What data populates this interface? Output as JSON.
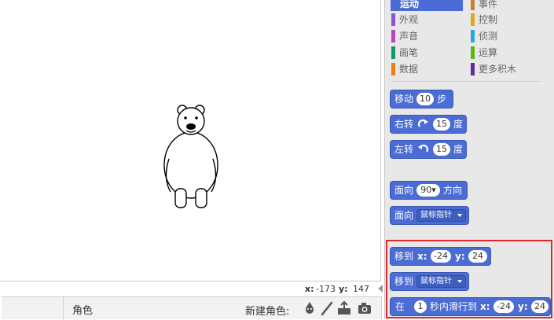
{
  "stage": {
    "coords_x_label": "x:",
    "coords_x_value": "-173",
    "coords_y_label": "y:",
    "coords_y_value": "147"
  },
  "sprite_bar": {
    "title": "角色",
    "new_sprite_label": "新建角色:"
  },
  "categories": {
    "left": [
      "运动",
      "外观",
      "声音",
      "画笔",
      "数据"
    ],
    "right": [
      "事件",
      "控制",
      "侦测",
      "运算",
      "更多积木"
    ],
    "left_colors": [
      "#4a6cd4",
      "#8a55d7",
      "#bb42c3",
      "#0e9a6c",
      "#ee7d16"
    ],
    "right_colors": [
      "#c88330",
      "#e1a91a",
      "#2ca5e2",
      "#5cb712",
      "#632d99"
    ],
    "selected": "运动"
  },
  "blocks": {
    "move": {
      "label": "移动",
      "value": "10",
      "unit": "步"
    },
    "turn_right": {
      "label": "右转",
      "icon": "rotate-cw-icon",
      "value": "15",
      "unit": "度"
    },
    "turn_left": {
      "label": "左转",
      "icon": "rotate-ccw-icon",
      "value": "15",
      "unit": "度"
    },
    "point_dir": {
      "label": "面向",
      "value": "90▾",
      "unit": "方向"
    },
    "point_towards": {
      "label": "面向",
      "dropdown": "鼠标指针"
    },
    "goto_xy": {
      "label": "移到",
      "x_label": "x:",
      "x_value": "-24",
      "y_label": "y:",
      "y_value": "24"
    },
    "goto_target": {
      "label": "移到",
      "dropdown": "鼠标指针"
    },
    "glide": {
      "label": "在",
      "secs": "1",
      "mid": "秒内滑行到",
      "x_label": "x:",
      "x_value": "-24",
      "y_label": "y:",
      "y_value": "24"
    }
  },
  "colors": {
    "motion": "#4a6cd4",
    "highlight": "#e0282e"
  }
}
